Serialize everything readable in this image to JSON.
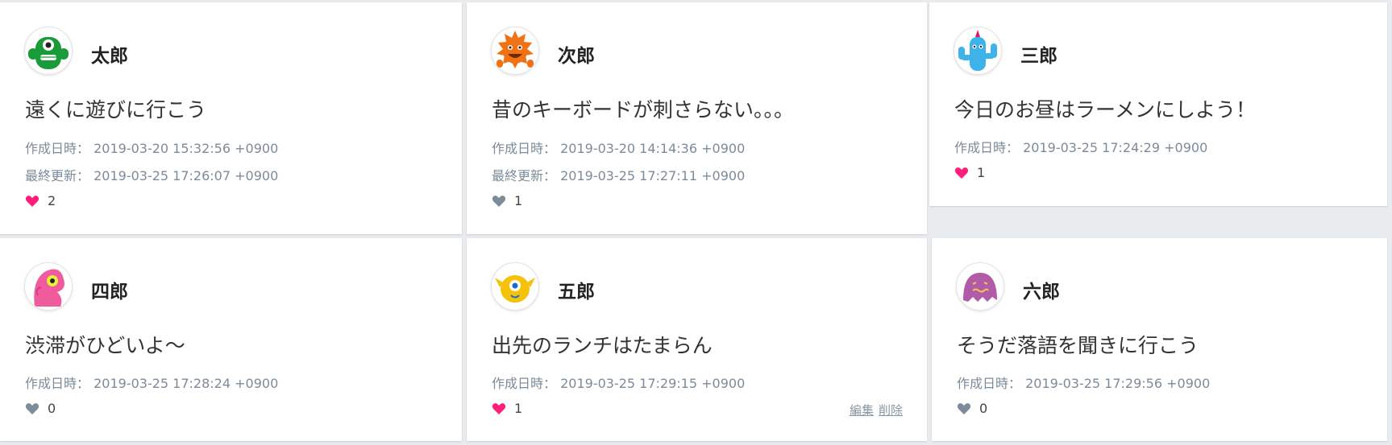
{
  "meta_labels": {
    "created": "作成日時：",
    "updated": "最終更新："
  },
  "posts": [
    {
      "name": "太郎",
      "body": "遠くに遊びに行こう",
      "created": "2019-03-20 15:32:56 +0900",
      "updated": "2019-03-25 17:26:07 +0900",
      "likes": "2",
      "liked": true,
      "avatar": "green-monster-icon"
    },
    {
      "name": "次郎",
      "body": "昔のキーボードが刺さらない。。。",
      "created": "2019-03-20 14:14:36 +0900",
      "updated": "2019-03-25 17:27:11 +0900",
      "likes": "1",
      "liked": false,
      "avatar": "orange-spiky-monster-icon"
    },
    {
      "name": "三郎",
      "body": "今日のお昼はラーメンにしよう！",
      "created": "2019-03-25 17:24:29 +0900",
      "likes": "1",
      "liked": true,
      "avatar": "blue-cactus-monster-icon"
    },
    {
      "name": "四郎",
      "body": "渋滞がひどいよ～",
      "created": "2019-03-25 17:28:24 +0900",
      "likes": "0",
      "liked": false,
      "avatar": "pink-monster-icon"
    },
    {
      "name": "五郎",
      "body": "出先のランチはたまらん",
      "created": "2019-03-25 17:29:15 +0900",
      "likes": "1",
      "liked": true,
      "avatar": "yellow-one-eyed-monster-icon",
      "actions": {
        "edit": "編集",
        "delete": "削除"
      }
    },
    {
      "name": "六郎",
      "body": "そうだ落語を聞きに行こう",
      "created": "2019-03-25 17:29:56 +0900",
      "likes": "0",
      "liked": false,
      "avatar": "purple-ghost-monster-icon"
    }
  ],
  "colors": {
    "liked": "#ff1f7a",
    "unliked": "#7d8c9a"
  }
}
